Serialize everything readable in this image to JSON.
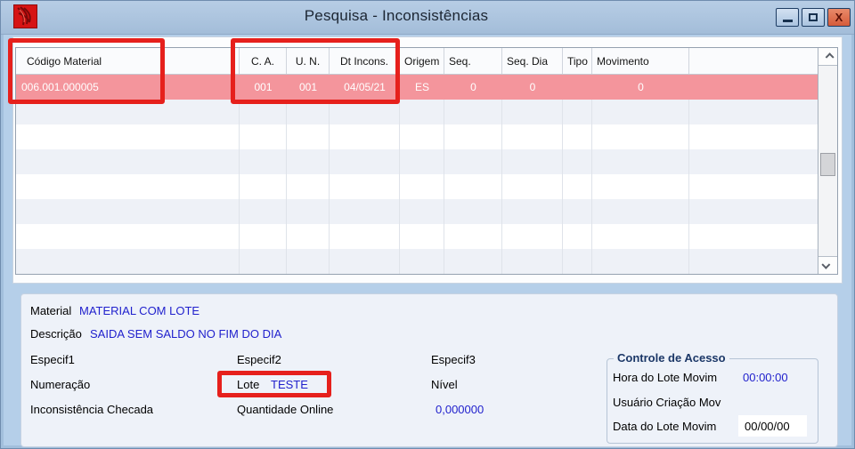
{
  "window": {
    "title": "Pesquisa - Inconsistências",
    "close_glyph": "X"
  },
  "table": {
    "columns": [
      "Código Material",
      "C. A.",
      "U. N.",
      "Dt Incons.",
      "Origem",
      "Seq.",
      "Seq. Dia",
      "Tipo",
      "Movimento",
      ""
    ],
    "rows": [
      {
        "selected": true,
        "cells": [
          "006.001.000005",
          "001",
          "001",
          "04/05/21",
          "ES",
          "0",
          "0",
          "",
          "0",
          ""
        ]
      }
    ],
    "empty_rows": 7
  },
  "details": {
    "material_label": "Material",
    "material_value": "MATERIAL COM LOTE",
    "descricao_label": "Descrição",
    "descricao_value": "SAIDA SEM SALDO NO FIM DO DIA",
    "especif1_label": "Especif1",
    "especif2_label": "Especif2",
    "especif3_label": "Especif3",
    "numeracao_label": "Numeração",
    "lote_label": "Lote",
    "lote_value": "TESTE",
    "nivel_label": "Nível",
    "inconsistencia_label": "Inconsistência Checada",
    "quantidade_label": "Quantidade Online",
    "quantidade_value": "0,000000"
  },
  "access": {
    "title": "Controle de Acesso",
    "hora_label": "Hora do Lote Movim",
    "hora_value": "00:00:00",
    "usuario_label": "Usuário Criação Mov",
    "data_label": "Data do Lote Movim",
    "data_value": "00/00/00"
  },
  "colors": {
    "selected_row": "#f4959c",
    "annotation_red": "#e6201c",
    "value_blue": "#2121cd",
    "titlebar_blue": "#aac3de"
  }
}
